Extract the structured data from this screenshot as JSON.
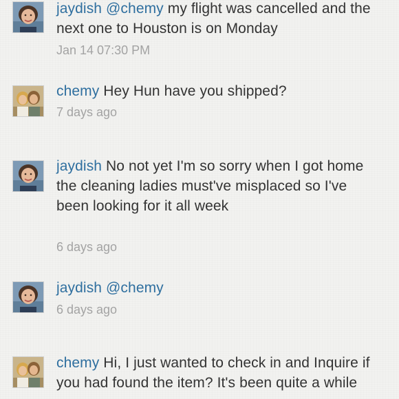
{
  "comments": [
    {
      "username": "jaydish",
      "mention": "@chemy",
      "message": " my flight was cancelled and the next one to Houston is on Monday",
      "timestamp": "Jan 14 07:30 PM",
      "avatar": "avatar-jaydish"
    },
    {
      "username": "chemy",
      "mention": "",
      "message": "Hey Hun have you shipped?",
      "timestamp": "7 days ago",
      "avatar": "avatar-chemy"
    },
    {
      "username": "jaydish",
      "mention": "",
      "message": "No not yet I'm so sorry when I got home the cleaning ladies must've misplaced so I've been looking for it all week",
      "timestamp": "6 days ago",
      "avatar": "avatar-jaydish"
    },
    {
      "username": "jaydish",
      "mention": "@chemy",
      "message": "",
      "timestamp": "6 days ago",
      "avatar": "avatar-jaydish"
    },
    {
      "username": "chemy",
      "mention": "",
      "message": "Hi, I just wanted to check in and Inquire if you had found the item?  It's been quite a while",
      "timestamp": "",
      "avatar": "avatar-chemy"
    }
  ],
  "colors": {
    "username": "#2f6f9f",
    "body_text": "#333333",
    "timestamp": "#a3a3a3",
    "background": "#f2f2f0"
  }
}
